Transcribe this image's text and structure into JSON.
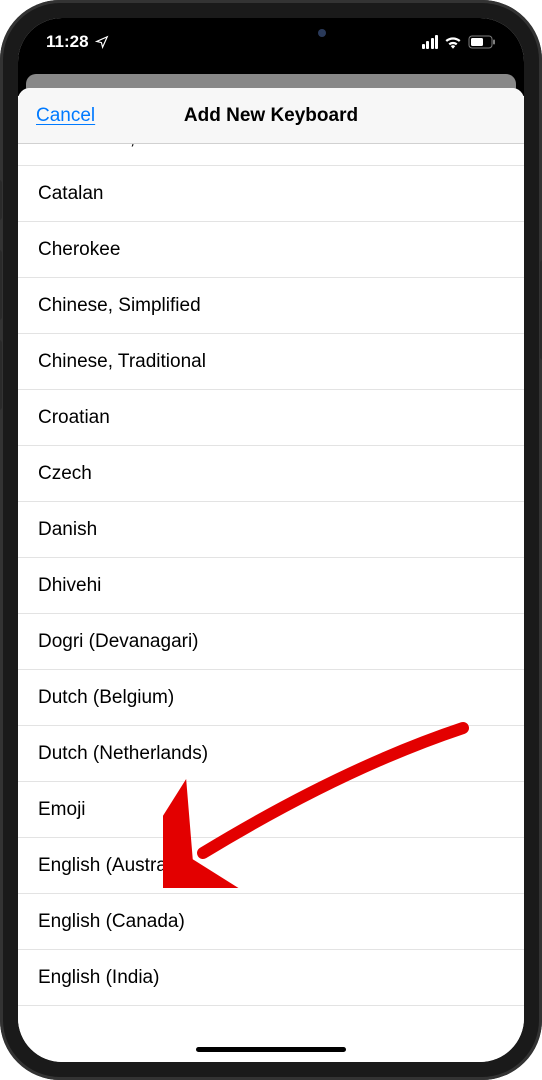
{
  "status": {
    "time": "11:28",
    "location_icon": "􀋑"
  },
  "nav": {
    "cancel": "Cancel",
    "title": "Add New Keyboard"
  },
  "keyboards": [
    "Cantonese, Traditional",
    "Catalan",
    "Cherokee",
    "Chinese, Simplified",
    "Chinese, Traditional",
    "Croatian",
    "Czech",
    "Danish",
    "Dhivehi",
    "Dogri (Devanagari)",
    "Dutch (Belgium)",
    "Dutch (Netherlands)",
    "Emoji",
    "English (Australia)",
    "English (Canada)",
    "English (India)"
  ]
}
